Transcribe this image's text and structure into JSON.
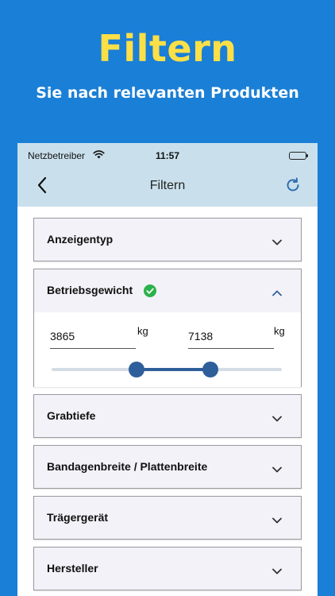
{
  "promo": {
    "title": "Filtern",
    "subtitle": "Sie nach relevanten Produkten"
  },
  "status_bar": {
    "carrier": "Netzbetreiber",
    "time": "11:57"
  },
  "nav": {
    "title": "Filtern",
    "back_icon": "chevron-left-icon",
    "refresh_icon": "refresh-icon"
  },
  "colors": {
    "background": "#1a7fd6",
    "title_yellow": "#fde047",
    "nav_bg": "#c9e0ec",
    "accent": "#2f5f9a",
    "check_green": "#2bb24c"
  },
  "filters": [
    {
      "label": "Anzeigentyp",
      "expanded": false
    },
    {
      "label": "Betriebsgewicht",
      "expanded": true,
      "active": true,
      "min_value": "3865",
      "max_value": "7138",
      "min_unit": "kg",
      "max_unit": "kg",
      "slider_min_fraction": 0.37,
      "slider_max_fraction": 0.69
    },
    {
      "label": "Grabtiefe",
      "expanded": false
    },
    {
      "label": "Bandagenbreite / Plattenbreite",
      "expanded": false
    },
    {
      "label": "Trägergerät",
      "expanded": false
    },
    {
      "label": "Hersteller",
      "expanded": false
    }
  ]
}
